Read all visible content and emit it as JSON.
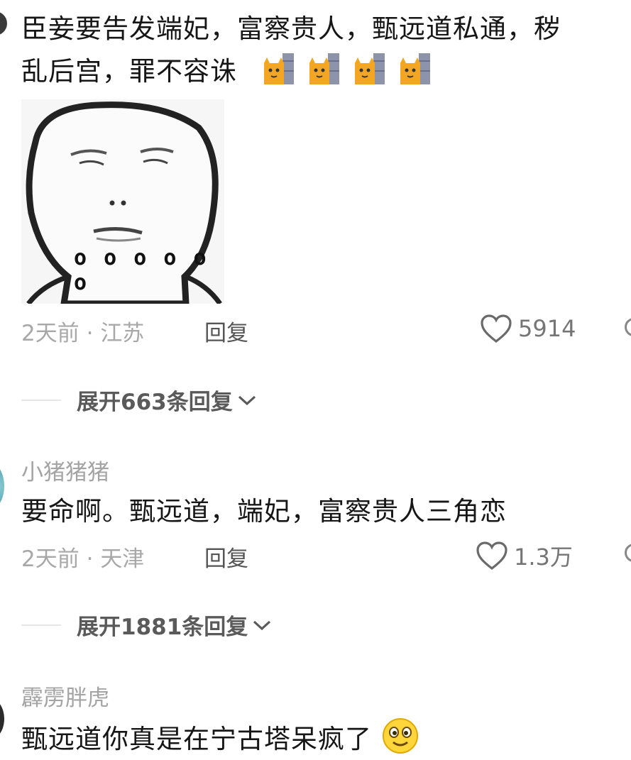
{
  "comments": [
    {
      "text_line1": "臣妾要告发端妃，富察贵人，甄远道私通，秽",
      "text_line2": "乱后宫，罪不容诛",
      "inline_emojis": [
        "cat-peek-emoji",
        "cat-peek-emoji",
        "cat-peek-emoji",
        "cat-peek-emoji"
      ],
      "sticker_dots": "o o o o o o",
      "time": "2天前",
      "location": "江苏",
      "reply_label": "回复",
      "likes": "5914",
      "expand_label": "展开663条回复"
    },
    {
      "username": "小猪猪猪",
      "text": "要命啊。甄远道，端妃，富察贵人三角恋",
      "time": "2天前",
      "location": "天津",
      "reply_label": "回复",
      "likes": "1.3万",
      "expand_label": "展开1881条回复"
    },
    {
      "username": "霹雳胖虎",
      "text": "甄远道你真是在宁古塔呆疯了",
      "emoji": "smile-emoji"
    }
  ],
  "meta_separator": "·",
  "colors": {
    "meta": "#a8a8a8",
    "text": "#161616",
    "expand": "#5a5a5a"
  }
}
